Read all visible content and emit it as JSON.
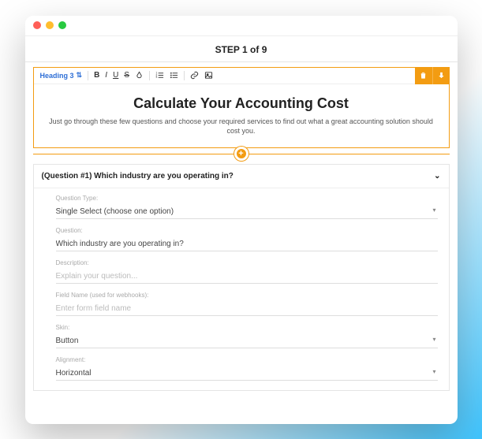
{
  "step_title": "STEP 1 of 9",
  "toolbar": {
    "heading_label": "Heading 3"
  },
  "hero": {
    "title": "Calculate Your Accounting Cost",
    "subtitle": "Just go through these few questions and choose your required services to find out what a great accounting solution should cost you."
  },
  "question": {
    "header": "(Question #1) Which industry are you operating in?",
    "fields": {
      "type_label": "Question Type:",
      "type_value": "Single Select (choose one option)",
      "question_label": "Question:",
      "question_value": "Which industry are you operating in?",
      "description_label": "Description:",
      "description_placeholder": "Explain your question...",
      "fieldname_label": "Field Name (used for webhooks):",
      "fieldname_placeholder": "Enter form field name",
      "skin_label": "Skin:",
      "skin_value": "Button",
      "alignment_label": "Alignment:",
      "alignment_value": "Horizontal"
    }
  }
}
